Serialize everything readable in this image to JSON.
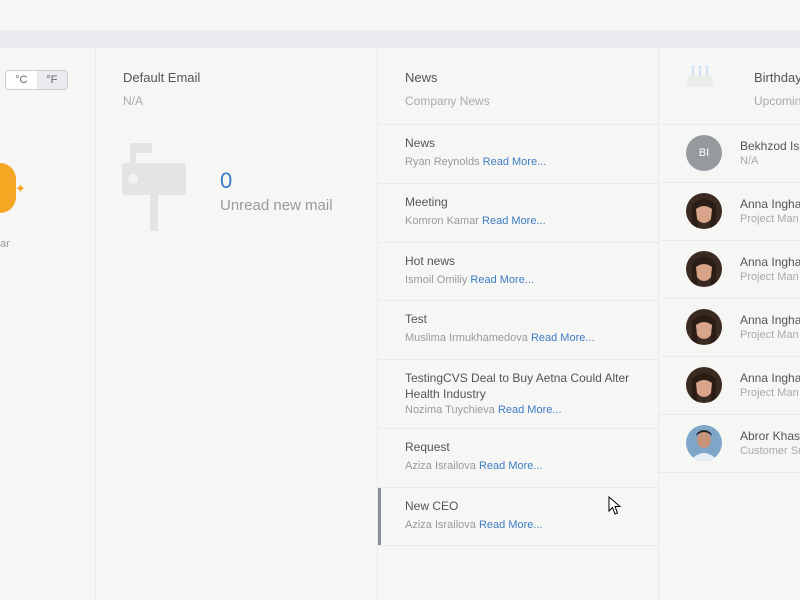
{
  "weather": {
    "unit_celsius": "°C",
    "unit_fahrenheit": "°F",
    "active_unit": "°F",
    "label": "ar",
    "sun_color": "#f5a623"
  },
  "email": {
    "title": "Default Email",
    "subtitle": "N/A",
    "unread_count": "0",
    "unread_label": "Unread new mail"
  },
  "news": {
    "title": "News",
    "subtitle": "Company News",
    "read_more_label": "Read More...",
    "items": [
      {
        "title": "News",
        "author": "Ryan Reynolds",
        "read_more": "Read More..."
      },
      {
        "title": "Meeting",
        "author": "Komron Kamar",
        "read_more": "Read More..."
      },
      {
        "title": "Hot news",
        "author": "Ismoil Omiliy",
        "read_more": "Read More..."
      },
      {
        "title": "Test",
        "author": "Muslima Irmukhamedova",
        "read_more": "Read More..."
      },
      {
        "title": "TestingCVS Deal to Buy Aetna Could Alter Health Industry",
        "author": "Nozima Tuychieva",
        "read_more": "Read More..."
      },
      {
        "title": "Request",
        "author": "Aziza Israilova",
        "read_more": "Read More..."
      },
      {
        "title": "New CEO",
        "author": "Aziza Israilova",
        "read_more": "Read More..."
      }
    ],
    "accent_color": "#3e7cc4"
  },
  "birthdays": {
    "title": "Birthday",
    "subtitle": "Upcomin",
    "people": [
      {
        "initials": "BI",
        "name": "Bekhzod Is",
        "role": "N/A",
        "avatar": "initials"
      },
      {
        "initials": "",
        "name": "Anna Ingha",
        "role": "Project Man",
        "avatar": "woman-photo"
      },
      {
        "initials": "",
        "name": "Anna Ingha",
        "role": "Project Man",
        "avatar": "woman-photo"
      },
      {
        "initials": "",
        "name": "Anna Ingha",
        "role": "Project Man",
        "avatar": "woman-photo"
      },
      {
        "initials": "",
        "name": "Anna Ingha",
        "role": "Project Man",
        "avatar": "woman-photo"
      },
      {
        "initials": "",
        "name": "Abror Khas",
        "role": "Customer Su",
        "avatar": "man-photo"
      }
    ]
  }
}
